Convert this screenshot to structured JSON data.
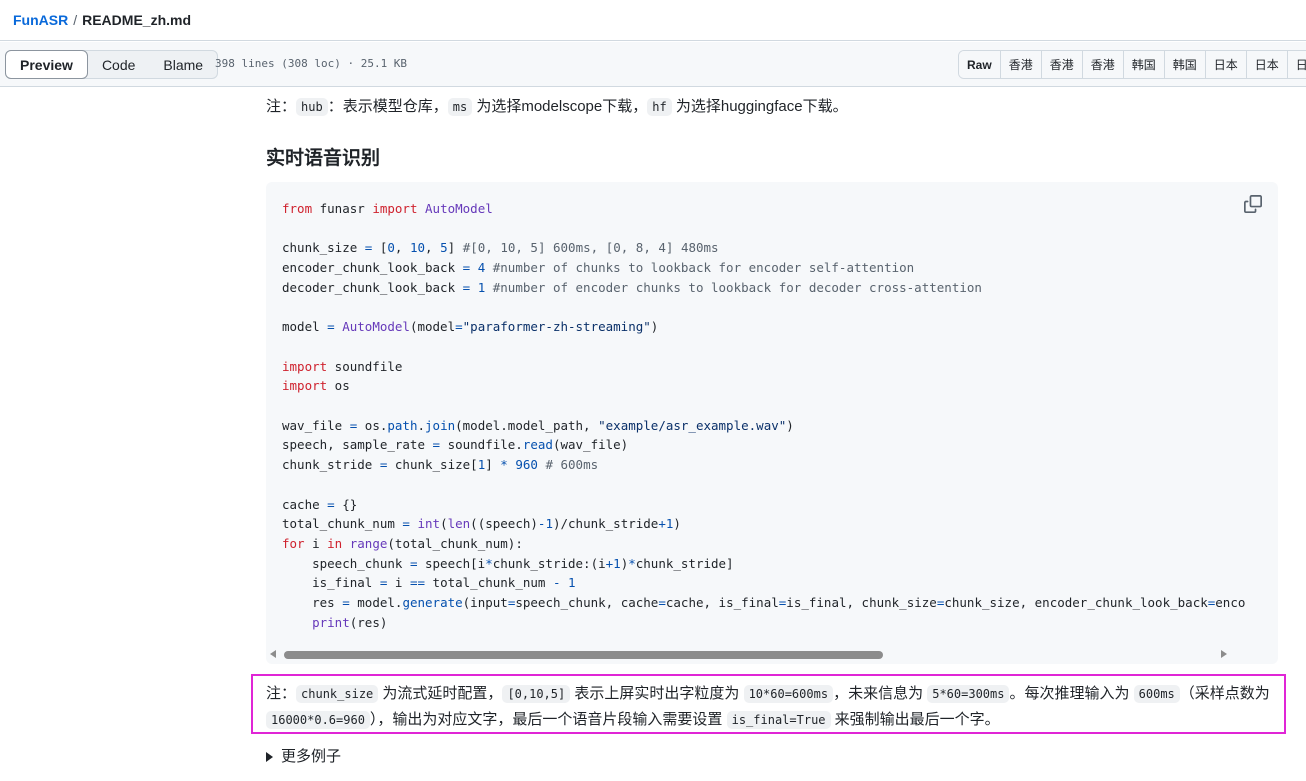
{
  "breadcrumb": {
    "repo": "FunASR",
    "sep": "/",
    "file": "README_zh.md"
  },
  "toolbar": {
    "tabs": [
      "Preview",
      "Code",
      "Blame"
    ],
    "file_info": "398 lines (308 loc) · 25.1 KB",
    "right_buttons": [
      "Raw",
      "香港",
      "香港",
      "香港",
      "韩国",
      "韩国",
      "日本",
      "日本",
      "日"
    ]
  },
  "note1": {
    "prefix": "注：",
    "code1": "hub",
    "t1": "：表示模型仓库，",
    "code2": "ms",
    "t2": " 为选择modelscope下载，",
    "code3": "hf",
    "t3": " 为选择huggingface下载。"
  },
  "heading": "实时语音识别",
  "code_lines": [
    "from funasr import AutoModel",
    "",
    "chunk_size = [0, 10, 5] #[0, 10, 5] 600ms, [0, 8, 4] 480ms",
    "encoder_chunk_look_back = 4 #number of chunks to lookback for encoder self-attention",
    "decoder_chunk_look_back = 1 #number of encoder chunks to lookback for decoder cross-attention",
    "",
    "model = AutoModel(model=\"paraformer-zh-streaming\")",
    "",
    "import soundfile",
    "import os",
    "",
    "wav_file = os.path.join(model.model_path, \"example/asr_example.wav\")",
    "speech, sample_rate = soundfile.read(wav_file)",
    "chunk_stride = chunk_size[1] * 960 # 600ms",
    "",
    "cache = {}",
    "total_chunk_num = int(len((speech)-1)/chunk_stride+1)",
    "for i in range(total_chunk_num):",
    "    speech_chunk = speech[i*chunk_stride:(i+1)*chunk_stride]",
    "    is_final = i == total_chunk_num - 1",
    "    res = model.generate(input=speech_chunk, cache=cache, is_final=is_final, chunk_size=chunk_size, encoder_chunk_look_back=enco",
    "    print(res)"
  ],
  "note2": {
    "prefix": "注：",
    "c1": "chunk_size",
    "t1": " 为流式延时配置，",
    "c2": "[0,10,5]",
    "t2": " 表示上屏实时出字粒度为 ",
    "c3": "10*60=600ms",
    "t3": "，未来信息为 ",
    "c4": "5*60=300ms",
    "t4": "。每次推理输入为 ",
    "c5": "600ms",
    "t5": "（采样点数为 ",
    "c6": "16000*0.6=960",
    "t6": "），输出为对应文字，最后一个语音片段输入需要设置 ",
    "c7": "is_final=True",
    "t7": " 来强制输出最后一个字。"
  },
  "more_examples": "更多例子",
  "colors": {
    "highlight_border": "#e025d6",
    "link": "#0969da"
  }
}
